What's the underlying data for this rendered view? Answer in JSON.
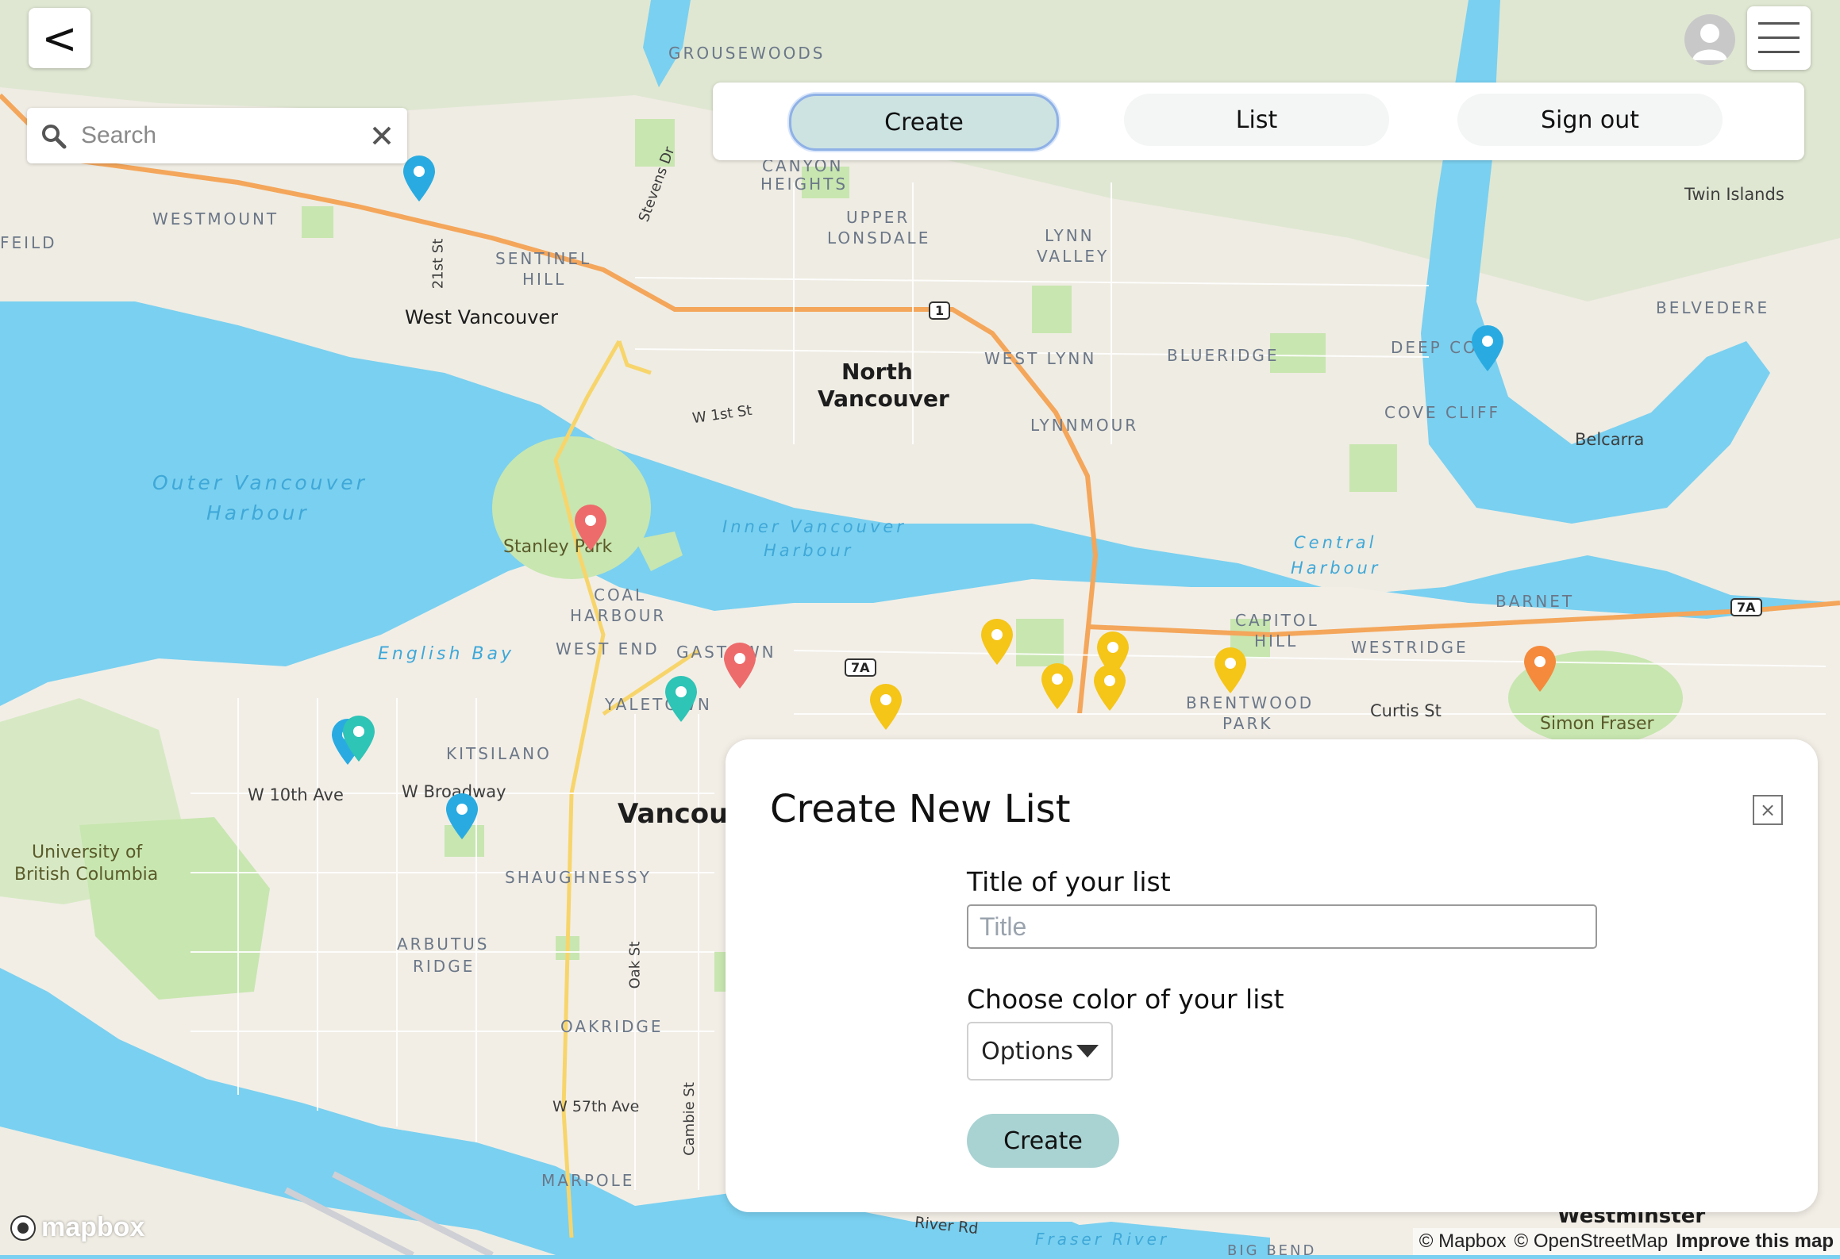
{
  "header": {
    "back_label": "<",
    "back_icon": "chevron-left-icon",
    "menu_icon": "hamburger-menu-icon",
    "avatar_icon": "user-avatar-icon"
  },
  "search": {
    "placeholder": "Search",
    "value": "",
    "icon": "search-icon",
    "clear_icon": "close-icon"
  },
  "nav": {
    "tabs": [
      {
        "label": "Create",
        "active": true
      },
      {
        "label": "List",
        "active": false
      },
      {
        "label": "Sign out",
        "active": false
      }
    ]
  },
  "modal": {
    "title": "Create New List",
    "close_label": "×",
    "title_field_label": "Title of your list",
    "title_placeholder": "Title",
    "color_field_label": "Choose color of your list",
    "options_label": "Options",
    "create_label": "Create"
  },
  "map": {
    "labels": {
      "grousewoods": "GROUSEWOODS",
      "canyon": "CANYON",
      "heights": "HEIGHTS",
      "upper": "UPPER",
      "lonsdale": "LONSDALE",
      "lynn": "LYNN",
      "valley": "VALLEY",
      "twin_islands": "Twin Islands",
      "westmount": "WESTMOUNT",
      "feild": "FEILD",
      "sentinel": "SENTINEL",
      "hill": "HILL",
      "west_vancouver": "West Vancouver",
      "st21": "21st St",
      "stevens": "Stevens Dr",
      "north": "North",
      "vancouver_nv": "Vancouver",
      "west_lynn": "WEST LYNN",
      "blueridge": "BLUERIDGE",
      "deep_cove": "DEEP COVE",
      "belvedere": "BELVEDERE",
      "cove_cliff": "COVE CLIFF",
      "belcarra": "Belcarra",
      "lynnmour": "LYNNMOUR",
      "w1st": "W 1st St",
      "outer1": "Outer Vancouver",
      "outer2": "Harbour",
      "inner1": "Inner Vancouver",
      "inner2": "Harbour",
      "central1": "Central",
      "central2": "Harbour",
      "stanley": "Stanley Park",
      "coal": "COAL",
      "harbour_ch": "HARBOUR",
      "west_end": "WEST END",
      "gastown": "GASTOWN",
      "english_bay": "English Bay",
      "capitol": "CAPITOL",
      "hill2": "HILL",
      "westridge": "WESTRIDGE",
      "barnet": "BARNET",
      "brentwood": "BRENTWOOD",
      "park": "PARK",
      "curtis": "Curtis St",
      "sfu": "Simon Fraser",
      "yaletown": "YALETOWN",
      "kitsilano": "KITSILANO",
      "w10": "W 10th Ave",
      "wbroadway": "W Broadway",
      "vancouver": "Vancouv",
      "ubc1": "University of",
      "ubc2": "British Columbia",
      "shaughnessy": "SHAUGHNESSY",
      "arbutus": "ARBUTUS",
      "ridge": "RIDGE",
      "oak": "Oak St",
      "oakridge": "OAKRIDGE",
      "w57": "W 57th Ave",
      "cambie": "Cambie St",
      "marpole": "MARPOLE",
      "river_rd": "River Rd",
      "fraser": "Fraser River",
      "big_bend": "BIG BEND",
      "westminster": "Westminster"
    },
    "shields": {
      "hwy1": "1",
      "hwy7a_1": "7A",
      "hwy7a_2": "7A"
    },
    "colors": {
      "water": "#7ad0f0",
      "land": "#f1ede4",
      "park": "#c8e6b0",
      "highway": "#f4a65a",
      "arterial": "#f7d56b"
    },
    "pins": [
      {
        "color": "#29abe2",
        "icon": "map-pin-icon"
      },
      {
        "color": "#29abe2",
        "icon": "map-pin-icon"
      },
      {
        "color": "#ee6b6b",
        "icon": "map-pin-icon"
      },
      {
        "color": "#ee6b6b",
        "icon": "map-pin-icon"
      },
      {
        "color": "#2ec4b6",
        "icon": "map-pin-icon"
      },
      {
        "color": "#29abe2",
        "icon": "map-pin-icon"
      },
      {
        "color": "#2ec4b6",
        "icon": "map-pin-icon"
      },
      {
        "color": "#29abe2",
        "icon": "map-pin-icon"
      },
      {
        "color": "#f5c518",
        "icon": "map-pin-icon"
      },
      {
        "color": "#f5c518",
        "icon": "map-pin-icon"
      },
      {
        "color": "#f5c518",
        "icon": "map-pin-icon"
      },
      {
        "color": "#f5c518",
        "icon": "map-pin-icon"
      },
      {
        "color": "#f5c518",
        "icon": "map-pin-icon"
      },
      {
        "color": "#f5c518",
        "icon": "map-pin-icon"
      },
      {
        "color": "#f58a3c",
        "icon": "map-pin-icon"
      }
    ]
  },
  "footer": {
    "logo_text": "mapbox",
    "attr_mapbox": "© Mapbox",
    "attr_osm": "© OpenStreetMap",
    "improve": "Improve this map"
  }
}
